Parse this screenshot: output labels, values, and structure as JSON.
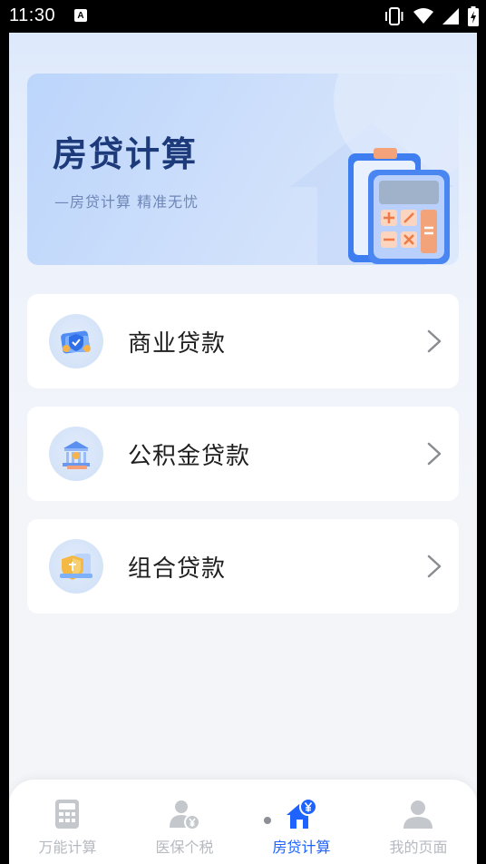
{
  "status_bar": {
    "time": "11:30",
    "badge": "A",
    "icons": [
      "vibrate-icon",
      "wifi-icon",
      "signal-icon",
      "battery-icon"
    ]
  },
  "banner": {
    "title": "房贷计算",
    "subtitle": "—房贷计算 精准无忧"
  },
  "loan_options": [
    {
      "label": "商业贷款",
      "icon": "shield-card-icon"
    },
    {
      "label": "公积金贷款",
      "icon": "bank-building-icon"
    },
    {
      "label": "组合贷款",
      "icon": "gold-shield-icon"
    }
  ],
  "tab_bar": {
    "tabs": [
      {
        "label": "万能计算",
        "icon": "calculator-icon",
        "active": false
      },
      {
        "label": "医保个税",
        "icon": "person-yuan-icon",
        "active": false
      },
      {
        "label": "房贷计算",
        "icon": "house-yuan-icon",
        "active": true
      },
      {
        "label": "我的页面",
        "icon": "profile-icon",
        "active": false
      }
    ]
  },
  "colors": {
    "accent": "#1e63ff",
    "banner_title": "#1d3a7a",
    "inactive_tab": "#b5b9c0"
  }
}
